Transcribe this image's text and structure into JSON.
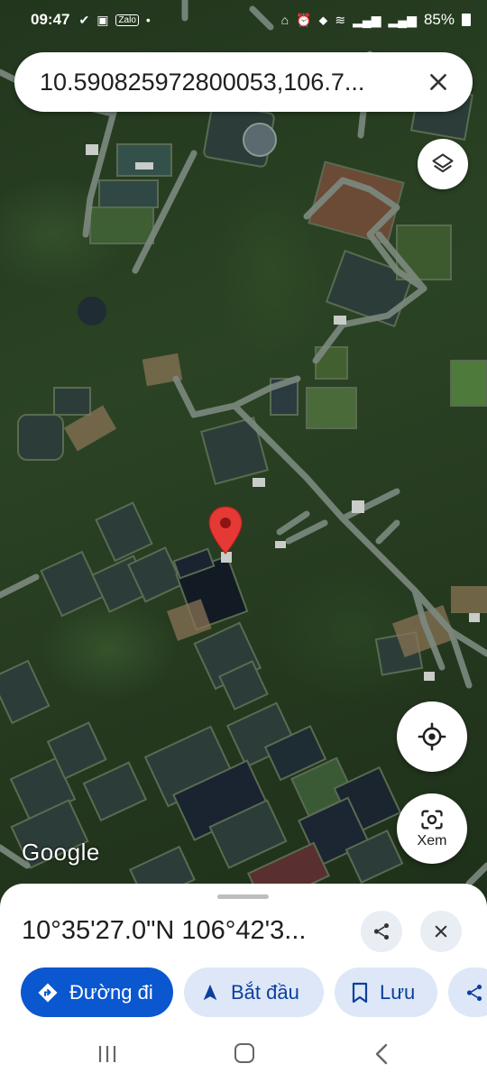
{
  "status_bar": {
    "time": "09:47",
    "left_icons": [
      "check-icon",
      "image-icon",
      "zalo-icon",
      "dot-icon"
    ],
    "right_icons": [
      "home-icon",
      "alarm-icon",
      "location-icon",
      "wifi-icon",
      "signal-icon",
      "signal-icon"
    ],
    "battery": "85%"
  },
  "search": {
    "query": "10.590825972800053,106.7...",
    "close_icon": "close-icon"
  },
  "map": {
    "attribution": "Google",
    "pin_color": "#e53935",
    "layers_icon": "layers-icon",
    "locate_icon": "my-location-icon",
    "lens_label": "Xem"
  },
  "sheet": {
    "title": "10°35'27.0\"N 106°42'3...",
    "actions": [
      {
        "label": "Đường đi",
        "icon": "directions-icon"
      },
      {
        "label": "Bắt đầu",
        "icon": "navigation-icon"
      },
      {
        "label": "Lưu",
        "icon": "bookmark-icon"
      },
      {
        "label": "",
        "icon": "share-icon"
      }
    ]
  },
  "colors": {
    "primary": "#0b57d0",
    "tonal_bg": "#dde7f8",
    "tonal_text": "#0b3f9c"
  }
}
